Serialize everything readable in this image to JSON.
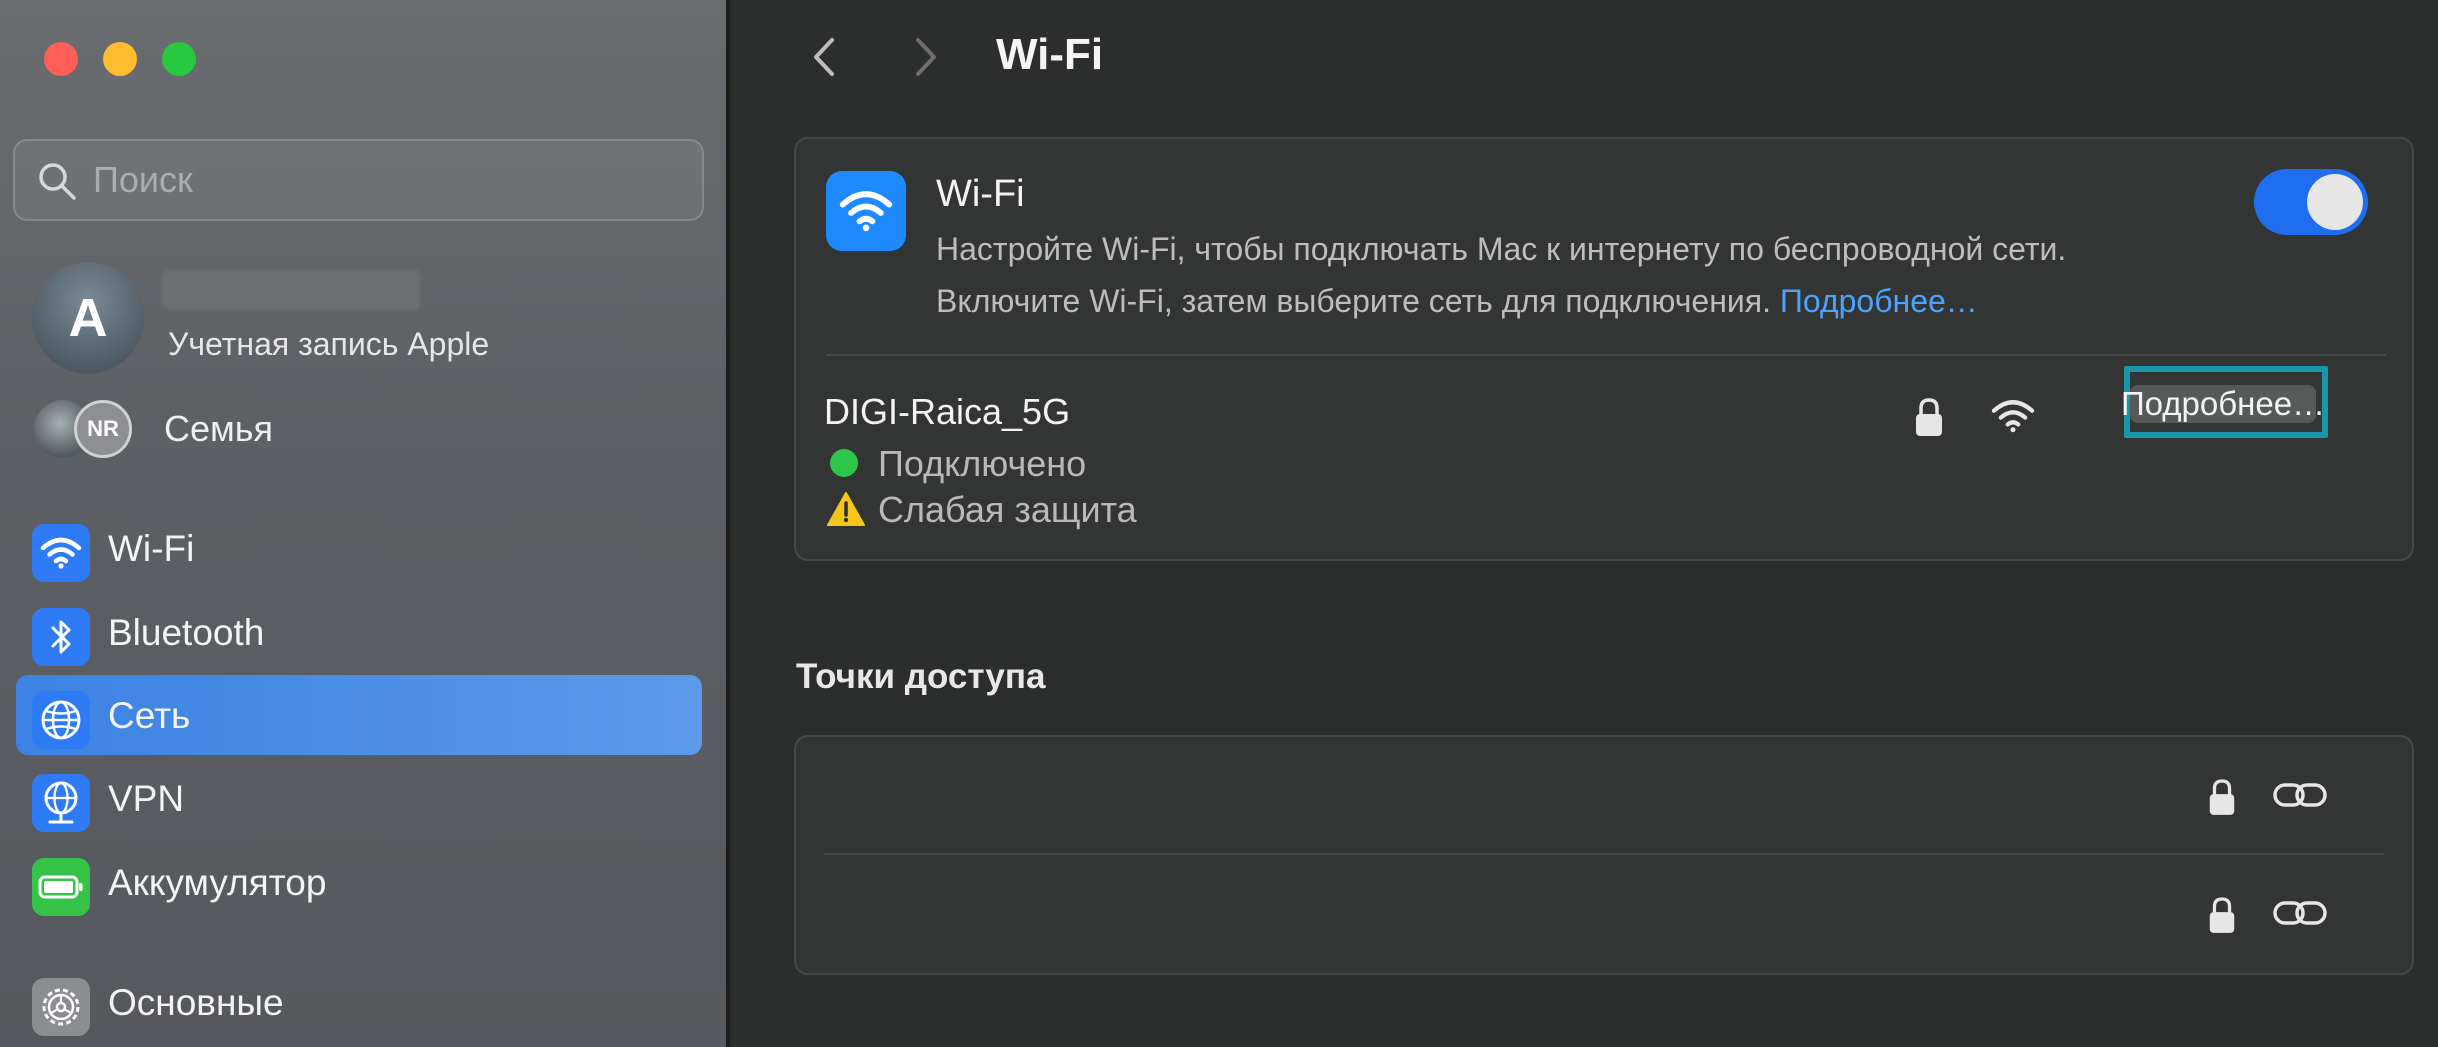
{
  "window": {
    "traffic_lights": {
      "close_color": "#fe5f57",
      "minimize_color": "#febc2e",
      "maximize_color": "#28c840"
    }
  },
  "sidebar": {
    "search": {
      "placeholder": "Поиск",
      "icon": "search-icon"
    },
    "account": {
      "avatar_letter": "A",
      "label": "Учетная запись Apple"
    },
    "family": {
      "avatar_initials": "NR",
      "label": "Семья"
    },
    "items": [
      {
        "label": "Wi-Fi",
        "icon": "wifi-icon",
        "icon_color": "#2f7bf5",
        "selected": false
      },
      {
        "label": "Bluetooth",
        "icon": "bluetooth-icon",
        "icon_color": "#2f7bf5",
        "selected": false
      },
      {
        "label": "Сеть",
        "icon": "globe-icon",
        "icon_color": "#2f7bf5",
        "selected": true
      },
      {
        "label": "VPN",
        "icon": "vpn-globe-icon",
        "icon_color": "#2f7bf5",
        "selected": false
      },
      {
        "label": "Аккумулятор",
        "icon": "battery-icon",
        "icon_color": "#36c34a",
        "selected": false
      },
      {
        "label": "Основные",
        "icon": "gear-icon",
        "icon_color": "#8b8d90",
        "selected": false
      }
    ]
  },
  "main": {
    "title": "Wi-Fi",
    "wifi_card": {
      "title": "Wi-Fi",
      "description_line1": "Настройте Wi-Fi, чтобы подключать Mac к интернету по беспроводной сети.",
      "description_line2": "Включите Wi-Fi, затем выберите сеть для подключения.",
      "more_link": "Подробнее…",
      "toggle_on": true,
      "toggle_color": "#1f6ef0",
      "network": {
        "name": "DIGI-Raica_5G",
        "status": "Подключено",
        "status_color": "#2ec74a",
        "warning": "Слабая защита",
        "details_button": "Подробнее…",
        "highlight_color": "#1996a8"
      }
    },
    "hotspots": {
      "title": "Точки доступа",
      "rows": [
        {
          "icons": [
            "lock-icon",
            "link-icon"
          ]
        },
        {
          "icons": [
            "lock-icon",
            "link-icon"
          ]
        }
      ]
    }
  }
}
